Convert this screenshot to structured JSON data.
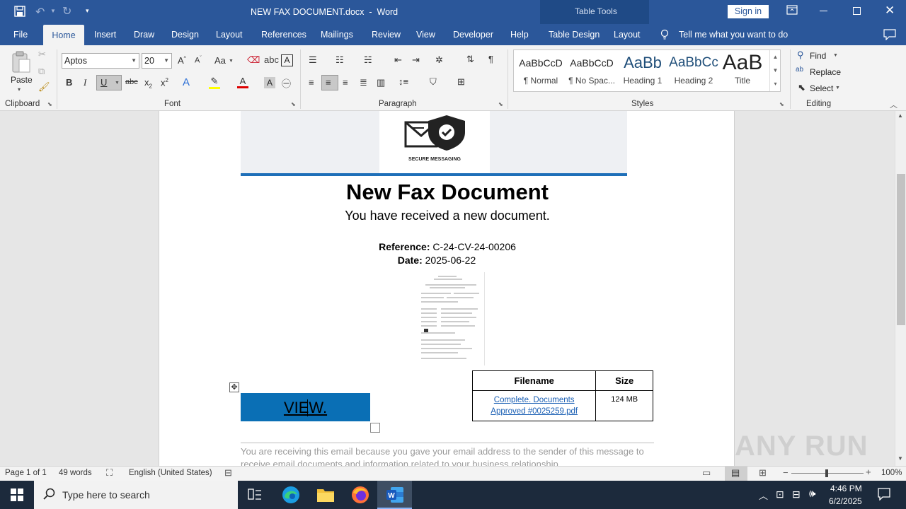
{
  "window": {
    "title": "NEW FAX DOCUMENT.docx  -  Word",
    "context_tab_group": "Table Tools",
    "sign_in": "Sign in"
  },
  "tabs": [
    "File",
    "Home",
    "Insert",
    "Draw",
    "Design",
    "Layout",
    "References",
    "Mailings",
    "Review",
    "View",
    "Developer",
    "Help",
    "Table Design",
    "Layout"
  ],
  "active_tab": "Home",
  "tell_me": "Tell me what you want to do",
  "ribbon": {
    "clipboard": {
      "paste": "Paste",
      "label": "Clipboard"
    },
    "font": {
      "name": "Aptos",
      "size": "20",
      "label": "Font",
      "change_case": "Aa"
    },
    "paragraph": {
      "label": "Paragraph"
    },
    "styles": {
      "label": "Styles",
      "items": [
        {
          "preview": "AaBbCcD",
          "name": "¶ Normal"
        },
        {
          "preview": "AaBbCcD",
          "name": "¶ No Spac..."
        },
        {
          "preview": "AaBb",
          "name": "Heading 1"
        },
        {
          "preview": "AaBbCc",
          "name": "Heading 2"
        },
        {
          "preview": "AaB",
          "name": "Title"
        }
      ]
    },
    "editing": {
      "label": "Editing",
      "find": "Find",
      "replace": "Replace",
      "select": "Select"
    }
  },
  "document": {
    "logo_caption": "SECURE MESSAGING",
    "heading": "New Fax Document",
    "subheading": "You have received a new document.",
    "reference_label": "Reference:",
    "reference_value": "C-24-CV-24-00206",
    "date_label": "Date:",
    "date_value": "2025-06-22",
    "view_button": "VIEW.",
    "table": {
      "headers": [
        "Filename",
        "Size"
      ],
      "rows": [
        {
          "filename": "Complete. Documents Approved #0025259.pdf",
          "size": "124 MB"
        }
      ]
    },
    "footer_text": "You are receiving this email because you gave your email address to the sender of this message to receive email documents and information related to your business relationship."
  },
  "status": {
    "page": "Page 1 of 1",
    "words": "49 words",
    "language": "English (United States)",
    "zoom": "100%"
  },
  "taskbar": {
    "search_placeholder": "Type here to search",
    "time": "4:46 PM",
    "date": "6/2/2025"
  },
  "watermark": "ANY RUN",
  "colors": {
    "word_blue": "#2b579a",
    "view_button_bg": "#0a6fb5",
    "logo_rule": "#1e6fb8",
    "link": "#1a5fb4"
  }
}
